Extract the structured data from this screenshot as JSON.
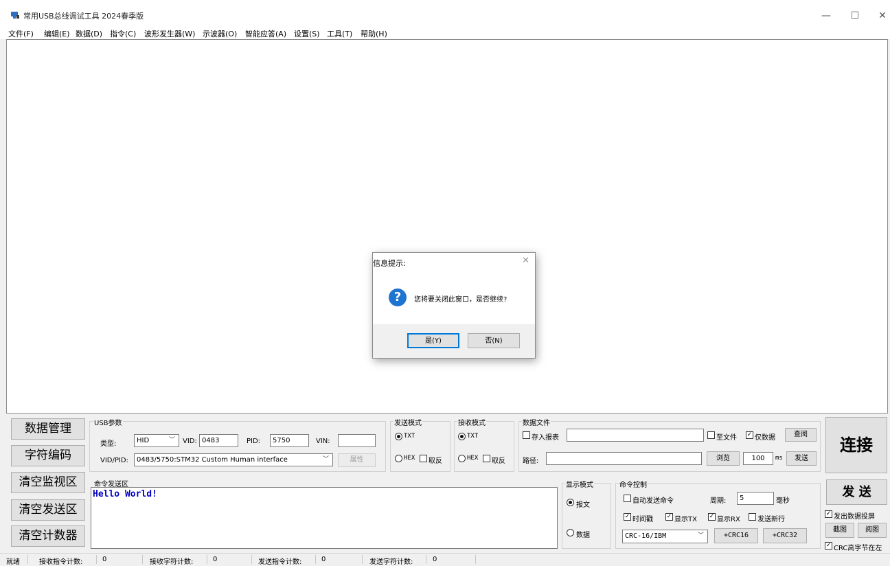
{
  "window": {
    "title": "常用USB总线调试工具 2024春季版",
    "minimize": "—",
    "maximize": "☐",
    "close": "✕"
  },
  "menu": [
    "文件(F)",
    "编辑(E)",
    "数据(D)",
    "指令(C)",
    "波形发生器(W)",
    "示波器(O)",
    "智能应答(A)",
    "设置(S)",
    "工具(T)",
    "帮助(H)"
  ],
  "dialog": {
    "title": "信息提示:",
    "close": "✕",
    "icon": "?",
    "message": "您将要关闭此窗口，是否继续?",
    "yes": "是(Y)",
    "no": "否(N)"
  },
  "left_buttons": [
    "数据管理",
    "字符编码",
    "清空监视区",
    "清空发送区",
    "清空计数器"
  ],
  "usb": {
    "title": "USB参数",
    "type_label": "类型:",
    "type_value": "HID",
    "vid_label": "VID:",
    "vid_value": "0483",
    "pid_label": "PID:",
    "pid_value": "5750",
    "vin_label": "VIN:",
    "vin_value": "",
    "vidpid_label": "VID/PID:",
    "vidpid_value": "0483/5750:STM32 Custom Human interface",
    "props": "属性"
  },
  "send_mode": {
    "title": "发送模式",
    "txt": "TXT",
    "hex": "HEX",
    "invert": "取反",
    "selected": "TXT"
  },
  "recv_mode": {
    "title": "接收模式",
    "txt": "TXT",
    "hex": "HEX",
    "invert": "取反",
    "selected": "TXT"
  },
  "data_file": {
    "title": "数据文件",
    "save_report": "存入报表",
    "to_file": "至文件",
    "data_only": "仅数据",
    "query": "查阅",
    "path_label": "路径:",
    "browse": "浏览",
    "interval": "100",
    "ms": "ms",
    "send": "发送",
    "save_report_checked": false,
    "to_file_checked": false,
    "data_only_checked": true
  },
  "connect": "连接",
  "command_area": {
    "title": "命令发送区",
    "text": "Hello World!"
  },
  "display_mode": {
    "title": "显示模式",
    "message": "报文",
    "data": "数据",
    "selected": "报文"
  },
  "cmd_control": {
    "title": "命令控制",
    "auto_send": "自动发送命令",
    "period_label": "周期:",
    "period_value": "5",
    "period_unit": "毫秒",
    "timestamp": "时间戳",
    "show_tx": "显示TX",
    "show_rx": "显示RX",
    "send_newline": "发送新行",
    "crc_select": "CRC-16/IBM",
    "crc16": "+CRC16",
    "crc32": "+CRC32",
    "auto_send_checked": false,
    "timestamp_checked": true,
    "show_tx_checked": true,
    "show_rx_checked": true,
    "send_newline_checked": false
  },
  "right": {
    "send": "发 送",
    "project": "发出数据投屏",
    "screenshot": "截图",
    "view": "阅图",
    "crc_high": "CRC高字节在左",
    "project_checked": true,
    "crc_high_checked": true
  },
  "status": {
    "ready": "就绪",
    "rx_cmd_label": "接收指令计数:",
    "rx_cmd": "0",
    "rx_char_label": "接收字符计数:",
    "rx_char": "0",
    "tx_cmd_label": "发送指令计数:",
    "tx_cmd": "0",
    "tx_char_label": "发送字符计数:",
    "tx_char": "0"
  }
}
